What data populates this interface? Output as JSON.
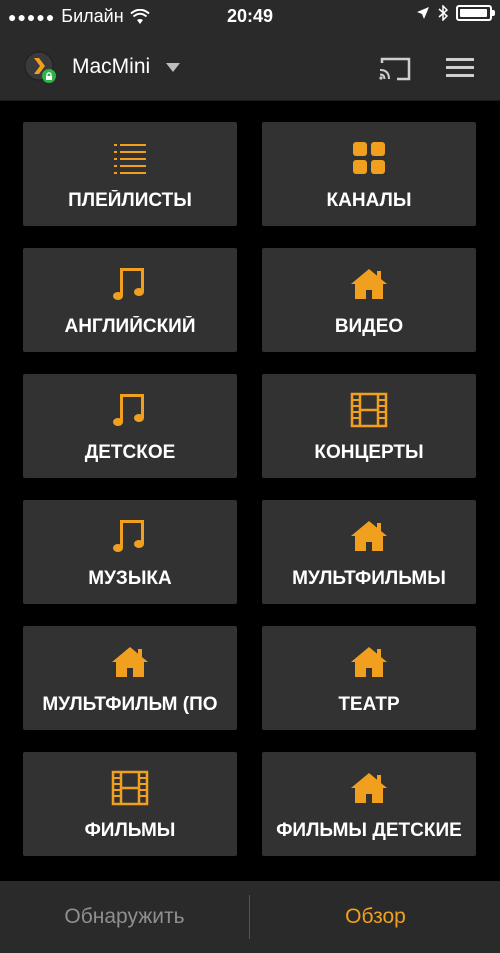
{
  "status_bar": {
    "carrier": "Билайн",
    "time": "20:49",
    "battery_level": 0.95
  },
  "nav": {
    "server_name": "MacMini",
    "icons": [
      "plex-logo-icon",
      "lock-icon",
      "chevron-down-icon",
      "cast-icon",
      "hamburger-menu-icon"
    ]
  },
  "accent_color": "#f0a01e",
  "tiles": [
    {
      "label": "ПЛЕЙЛИСТЫ",
      "icon": "list-icon"
    },
    {
      "label": "КАНАЛЫ",
      "icon": "grid-icon"
    },
    {
      "label": "АНГЛИЙСКИЙ",
      "icon": "music-icon"
    },
    {
      "label": "ВИДЕО",
      "icon": "home-icon"
    },
    {
      "label": "ДЕТСКОЕ",
      "icon": "music-icon"
    },
    {
      "label": "КОНЦЕРТЫ",
      "icon": "film-icon"
    },
    {
      "label": "МУЗЫКА",
      "icon": "music-icon"
    },
    {
      "label": "МУЛЬТФИЛЬМЫ",
      "icon": "home-icon"
    },
    {
      "label": "МУЛЬТФИЛЬМ (ПО",
      "icon": "home-icon"
    },
    {
      "label": "ТЕАТР",
      "icon": "home-icon"
    },
    {
      "label": "ФИЛЬМЫ",
      "icon": "film-icon"
    },
    {
      "label": "ФИЛЬМЫ ДЕТСКИЕ",
      "icon": "home-icon"
    }
  ],
  "tabs": {
    "discover": "Обнаружить",
    "browse": "Обзор"
  }
}
